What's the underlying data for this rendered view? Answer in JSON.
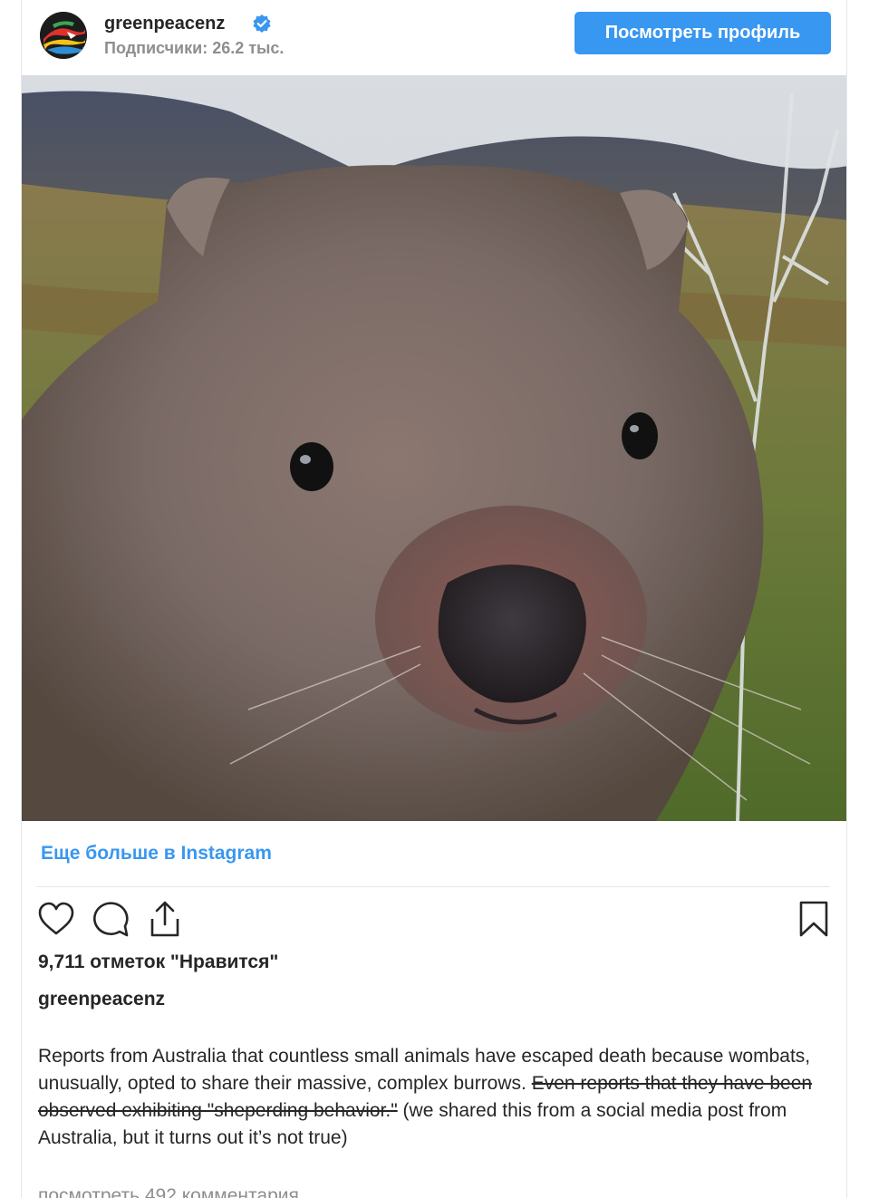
{
  "header": {
    "username": "greenpeacenz",
    "followers": "Подписчики: 26.2 тыс.",
    "view_profile_label": "Посмотреть профиль"
  },
  "photo": {
    "subject": "wombat"
  },
  "more_link": "Еще больше в Instagram",
  "actions": {
    "icons": [
      "heart-icon",
      "comment-icon",
      "share-icon",
      "bookmark-icon"
    ]
  },
  "likes": "9,711 отметок \"Нравится\"",
  "caption": {
    "username": "greenpeacenz",
    "line1": "Reports from Australia that countless small animals have escaped death because wombats, unusually, opted to share their massive, complex burrows.",
    "struck": "Even reports that they have been observed exhibiting \"sheperding behavior.\"",
    "line3": "(we shared this from a social media post from Australia, but it turns out it’s not true)"
  },
  "comments_link": "посмотреть 492 комментария",
  "colors": {
    "accent": "#3897f0",
    "text": "#262626",
    "muted": "#8e8e8e",
    "border": "#e6e6e6"
  }
}
